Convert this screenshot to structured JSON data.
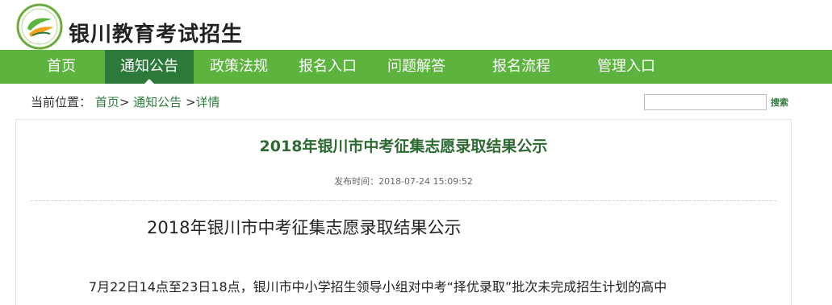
{
  "header": {
    "site_title": "银川教育考试招生",
    "logo_icon": "leaf-logo-icon"
  },
  "nav": {
    "items": [
      {
        "label": "首页"
      },
      {
        "label": "通知公告",
        "active": true
      },
      {
        "label": "政策法规"
      },
      {
        "label": "报名入口"
      },
      {
        "label": "问题解答"
      },
      {
        "label": "报名流程"
      },
      {
        "label": "管理入口"
      }
    ]
  },
  "breadcrumb": {
    "prefix": "当前位置：",
    "home": "首页",
    "sep1": ">",
    "section": "通知公告",
    "sep2": ">",
    "current": "详情"
  },
  "search": {
    "value": "",
    "button_label": "搜索"
  },
  "article": {
    "title": "2018年银川市中考征集志愿录取结果公示",
    "publish_time": "发布时间：2018-07-24 15:09:52",
    "body_heading": "2018年银川市中考征集志愿录取结果公示",
    "body_text": "7月22日14点至23日18点，银川市中小学招生领导小组对中考“择优录取”批次未完成招生计划的高中"
  },
  "colors": {
    "nav_green": "#5cb33d",
    "nav_active": "#2b7a3a",
    "title_green": "#2d6a33",
    "link_green": "#2f7a3b"
  }
}
